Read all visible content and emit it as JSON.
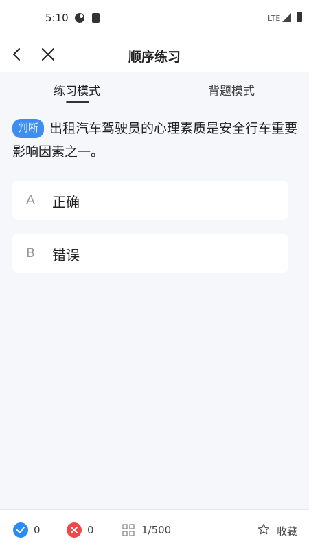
{
  "status_bar": {
    "time": "5:10",
    "network": "LTE"
  },
  "nav": {
    "title": "顺序练习"
  },
  "tabs": [
    {
      "label": "练习模式",
      "active": true
    },
    {
      "label": "背题模式",
      "active": false
    }
  ],
  "question": {
    "type_badge": "判断",
    "text": "出租汽车驾驶员的心理素质是安全行车重要影响因素之一。"
  },
  "options": [
    {
      "letter": "A",
      "text": "正确"
    },
    {
      "letter": "B",
      "text": "错误"
    }
  ],
  "footer": {
    "correct_count": "0",
    "wrong_count": "0",
    "progress": "1/500",
    "favorite_label": "收藏"
  },
  "colors": {
    "badge": "#3d8ef0",
    "correct": "#2a8bf2",
    "wrong": "#f04848",
    "background": "#f5f7fa"
  },
  "icons": {
    "nav": [
      "back-arrow-icon",
      "close-icon"
    ],
    "footer": [
      "check-circle-icon",
      "x-circle-icon",
      "grid-icon",
      "star-icon"
    ]
  }
}
